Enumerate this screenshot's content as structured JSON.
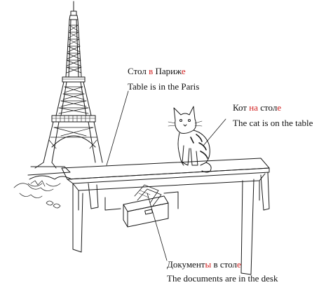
{
  "colors": {
    "text": "#111111",
    "highlight": "#d21f1f",
    "line": "#1a1a1a"
  },
  "labels": {
    "paris": {
      "ru": [
        {
          "text": "Стол ",
          "highlight": false
        },
        {
          "text": "в",
          "highlight": true
        },
        {
          "text": " Париж",
          "highlight": false
        },
        {
          "text": "е",
          "highlight": true
        }
      ],
      "en": "Table is in the Paris"
    },
    "cat": {
      "ru": [
        {
          "text": "Кот ",
          "highlight": false
        },
        {
          "text": "на",
          "highlight": true
        },
        {
          "text": " стол",
          "highlight": false
        },
        {
          "text": "е",
          "highlight": true
        }
      ],
      "en": "The cat is on the table"
    },
    "documents": {
      "ru": [
        {
          "text": "Документ",
          "highlight": false
        },
        {
          "text": "ы",
          "highlight": true
        },
        {
          "text": " в стол",
          "highlight": false
        },
        {
          "text": "е",
          "highlight": true
        }
      ],
      "en": "The documents are in the desk"
    }
  },
  "illustration": {
    "items": [
      "eiffel-tower",
      "table",
      "cat",
      "drawer",
      "documents"
    ]
  }
}
